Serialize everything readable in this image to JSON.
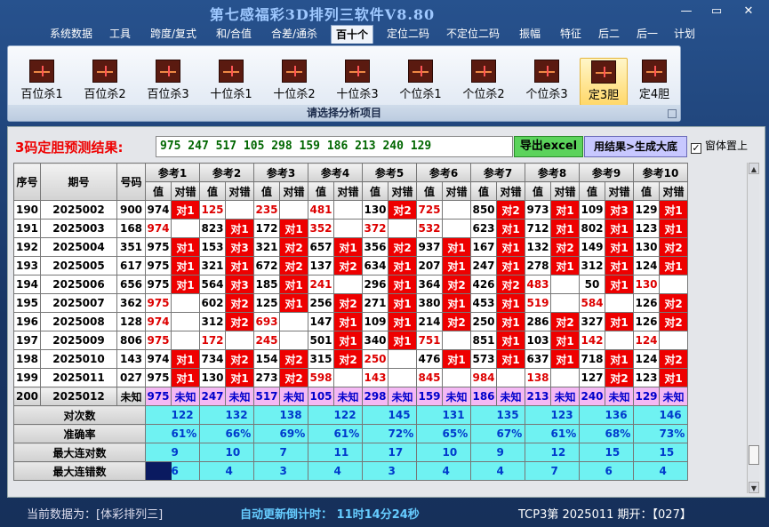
{
  "window": {
    "title": "第七感福彩3D排列三软件V8.80",
    "min": "—",
    "max": "▭",
    "close": "✕"
  },
  "menu": [
    "系统数据",
    "工具",
    "跨度/复式",
    "和/合值",
    "合差/通杀",
    "百十个",
    "定位二码",
    "不定位二码",
    "振幅",
    "特征",
    "后二",
    "后一",
    "计划"
  ],
  "ribbon": {
    "buttons": [
      "百位杀1",
      "百位杀2",
      "百位杀3",
      "十位杀1",
      "十位杀2",
      "十位杀3",
      "个位杀1",
      "个位杀2",
      "个位杀3",
      "定3胆",
      "定4胆"
    ],
    "selected": "定3胆",
    "footer": "请选择分析项目"
  },
  "prediction": {
    "label": "3码定胆预测结果:",
    "value": "975 247 517 105 298 159 186 213 240 129",
    "excel_btn": "导出excel",
    "gen_btn": "用结果>生成大底",
    "top_check": "窗体置上",
    "top_checked": true
  },
  "table": {
    "fixed_headers": [
      "序号",
      "期号",
      "号码"
    ],
    "refs": [
      "参考1",
      "参考2",
      "参考3",
      "参考4",
      "参考5",
      "参考6",
      "参考7",
      "参考8",
      "参考9",
      "参考10"
    ],
    "sub": [
      "值",
      "对错"
    ],
    "rows": [
      {
        "seq": "190",
        "period": "2025002",
        "num": "900",
        "cells": [
          [
            "974",
            "对1"
          ],
          [
            "125",
            ""
          ],
          [
            "235",
            ""
          ],
          [
            "481",
            ""
          ],
          [
            "130",
            "对2"
          ],
          [
            "725",
            ""
          ],
          [
            "850",
            "对2"
          ],
          [
            "973",
            "对1"
          ],
          [
            "109",
            "对3"
          ],
          [
            "129",
            "对1"
          ]
        ]
      },
      {
        "seq": "191",
        "period": "2025003",
        "num": "168",
        "cells": [
          [
            "974",
            ""
          ],
          [
            "823",
            "对1"
          ],
          [
            "172",
            "对1"
          ],
          [
            "352",
            ""
          ],
          [
            "372",
            ""
          ],
          [
            "532",
            ""
          ],
          [
            "623",
            "对1"
          ],
          [
            "712",
            "对1"
          ],
          [
            "802",
            "对1"
          ],
          [
            "123",
            "对1"
          ]
        ]
      },
      {
        "seq": "192",
        "period": "2025004",
        "num": "351",
        "cells": [
          [
            "975",
            "对1"
          ],
          [
            "153",
            "对3"
          ],
          [
            "321",
            "对2"
          ],
          [
            "657",
            "对1"
          ],
          [
            "356",
            "对2"
          ],
          [
            "937",
            "对1"
          ],
          [
            "167",
            "对1"
          ],
          [
            "132",
            "对2"
          ],
          [
            "149",
            "对1"
          ],
          [
            "130",
            "对2"
          ]
        ]
      },
      {
        "seq": "193",
        "period": "2025005",
        "num": "617",
        "cells": [
          [
            "975",
            "对1"
          ],
          [
            "321",
            "对1"
          ],
          [
            "672",
            "对2"
          ],
          [
            "137",
            "对2"
          ],
          [
            "634",
            "对1"
          ],
          [
            "207",
            "对1"
          ],
          [
            "247",
            "对1"
          ],
          [
            "278",
            "对1"
          ],
          [
            "312",
            "对1"
          ],
          [
            "124",
            "对1"
          ]
        ]
      },
      {
        "seq": "194",
        "period": "2025006",
        "num": "656",
        "cells": [
          [
            "975",
            "对1"
          ],
          [
            "564",
            "对3"
          ],
          [
            "185",
            "对1"
          ],
          [
            "241",
            ""
          ],
          [
            "296",
            "对1"
          ],
          [
            "364",
            "对2"
          ],
          [
            "426",
            "对2"
          ],
          [
            "483",
            ""
          ],
          [
            "50",
            "对1"
          ],
          [
            "130",
            ""
          ]
        ]
      },
      {
        "seq": "195",
        "period": "2025007",
        "num": "362",
        "cells": [
          [
            "975",
            ""
          ],
          [
            "602",
            "对2"
          ],
          [
            "125",
            "对1"
          ],
          [
            "256",
            "对2"
          ],
          [
            "271",
            "对1"
          ],
          [
            "380",
            "对1"
          ],
          [
            "453",
            "对1"
          ],
          [
            "519",
            ""
          ],
          [
            "584",
            ""
          ],
          [
            "126",
            "对2"
          ]
        ]
      },
      {
        "seq": "196",
        "period": "2025008",
        "num": "128",
        "cells": [
          [
            "974",
            ""
          ],
          [
            "312",
            "对2"
          ],
          [
            "693",
            ""
          ],
          [
            "147",
            "对1"
          ],
          [
            "109",
            "对1"
          ],
          [
            "214",
            "对2"
          ],
          [
            "250",
            "对1"
          ],
          [
            "286",
            "对2"
          ],
          [
            "327",
            "对1"
          ],
          [
            "126",
            "对2"
          ]
        ]
      },
      {
        "seq": "197",
        "period": "2025009",
        "num": "806",
        "cells": [
          [
            "975",
            ""
          ],
          [
            "172",
            ""
          ],
          [
            "245",
            ""
          ],
          [
            "501",
            "对1"
          ],
          [
            "340",
            "对1"
          ],
          [
            "751",
            ""
          ],
          [
            "851",
            "对1"
          ],
          [
            "103",
            "对1"
          ],
          [
            "142",
            ""
          ],
          [
            "124",
            ""
          ]
        ]
      },
      {
        "seq": "198",
        "period": "2025010",
        "num": "143",
        "cells": [
          [
            "974",
            "对1"
          ],
          [
            "734",
            "对2"
          ],
          [
            "154",
            "对2"
          ],
          [
            "315",
            "对2"
          ],
          [
            "250",
            ""
          ],
          [
            "476",
            "对1"
          ],
          [
            "573",
            "对1"
          ],
          [
            "637",
            "对1"
          ],
          [
            "718",
            "对1"
          ],
          [
            "124",
            "对2"
          ]
        ]
      },
      {
        "seq": "199",
        "period": "2025011",
        "num": "027",
        "cells": [
          [
            "975",
            "对1"
          ],
          [
            "130",
            "对1"
          ],
          [
            "273",
            "对2"
          ],
          [
            "598",
            ""
          ],
          [
            "143",
            ""
          ],
          [
            "845",
            ""
          ],
          [
            "984",
            ""
          ],
          [
            "138",
            ""
          ],
          [
            "127",
            "对2"
          ],
          [
            "123",
            "对1"
          ]
        ]
      }
    ],
    "predict_row": {
      "seq": "200",
      "period": "2025012",
      "num": "未知",
      "cells": [
        [
          "975",
          "未知"
        ],
        [
          "247",
          "未知"
        ],
        [
          "517",
          "未知"
        ],
        [
          "105",
          "未知"
        ],
        [
          "298",
          "未知"
        ],
        [
          "159",
          "未知"
        ],
        [
          "186",
          "未知"
        ],
        [
          "213",
          "未知"
        ],
        [
          "240",
          "未知"
        ],
        [
          "129",
          "未知"
        ]
      ]
    },
    "stats": [
      {
        "label": "对次数",
        "vals": [
          "122",
          "132",
          "138",
          "122",
          "145",
          "131",
          "135",
          "123",
          "136",
          "146"
        ]
      },
      {
        "label": "准确率",
        "vals": [
          "61%",
          "66%",
          "69%",
          "61%",
          "72%",
          "65%",
          "67%",
          "61%",
          "68%",
          "73%"
        ]
      },
      {
        "label": "最大连对数",
        "vals": [
          "9",
          "10",
          "7",
          "11",
          "17",
          "10",
          "9",
          "12",
          "15",
          "15"
        ]
      },
      {
        "label": "最大连错数",
        "vals": [
          "6",
          "4",
          "3",
          "4",
          "3",
          "4",
          "4",
          "7",
          "6",
          "4"
        ]
      }
    ]
  },
  "status": {
    "data": "当前数据为：[体彩排列三]",
    "countdown": "自动更新倒计时：  11时14分24秒",
    "period": "TCP3第 2025011 期开：【027】"
  }
}
